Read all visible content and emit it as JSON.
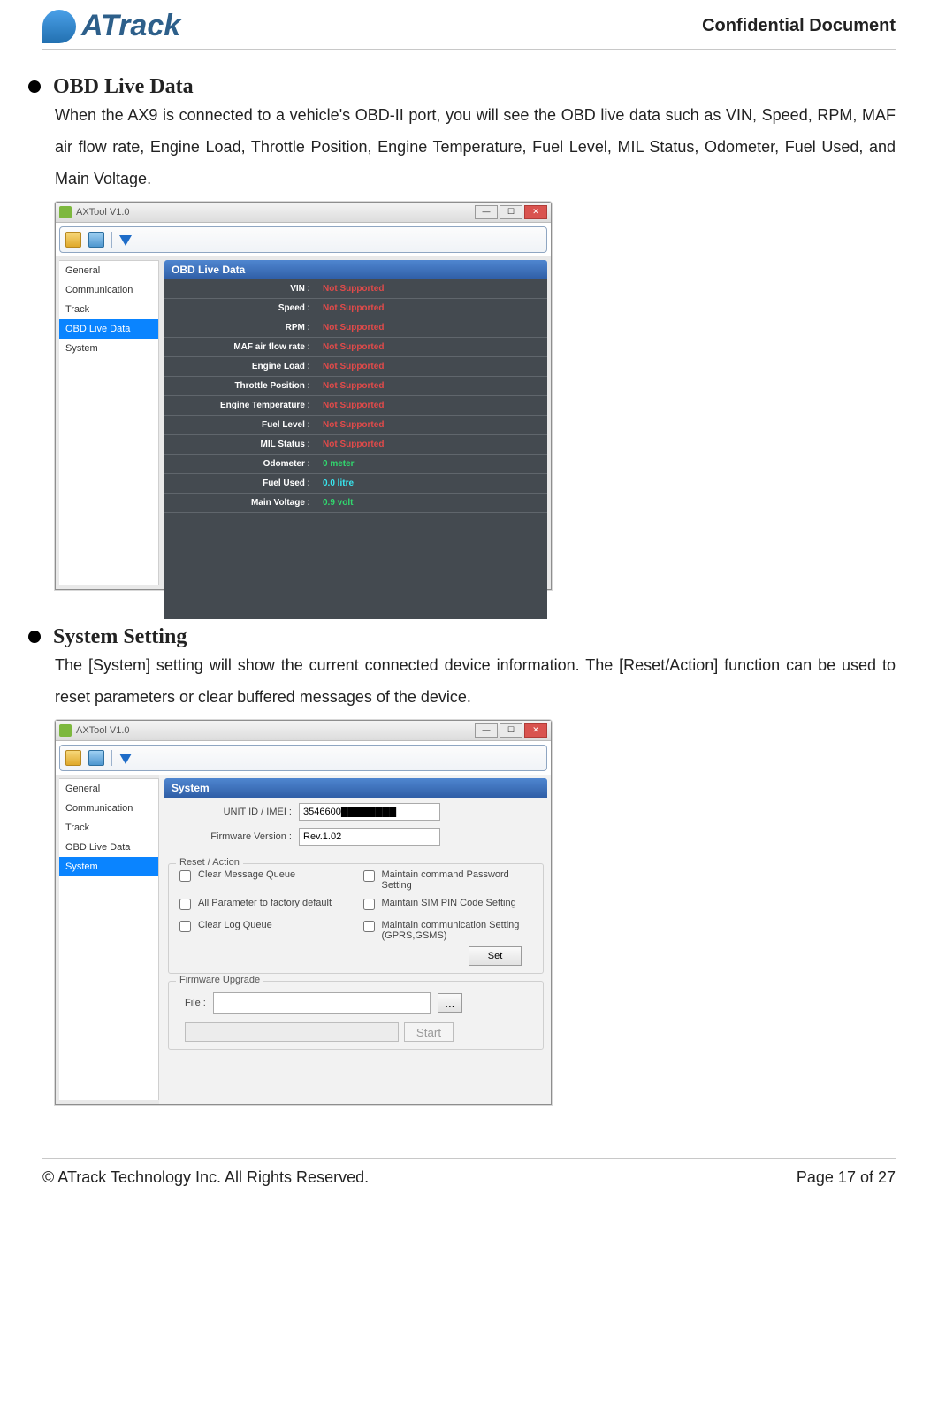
{
  "header": {
    "logo_text": "ATrack",
    "confidential": "Confidential Document"
  },
  "section1": {
    "title": "OBD Live Data",
    "body": "When the AX9 is connected to a vehicle's OBD-II port, you will see the OBD live data such as VIN, Speed, RPM, MAF air flow rate, Engine Load, Throttle Position, Engine Temperature, Fuel Level, MIL Status, Odometer, Fuel Used, and Main Voltage."
  },
  "section2": {
    "title": "System Setting",
    "body": "The [System] setting will show the current connected device information. The [Reset/Action] function can be used to reset parameters or clear buffered messages of the device."
  },
  "axtool": {
    "title": "AXTool V1.0",
    "sidebar": [
      "General",
      "Communication",
      "Track",
      "OBD Live Data",
      "System"
    ]
  },
  "obd": {
    "panel_title": "OBD Live Data",
    "rows": [
      {
        "label": "VIN :",
        "value": "Not Supported",
        "cls": "red"
      },
      {
        "label": "Speed :",
        "value": "Not Supported",
        "cls": "red"
      },
      {
        "label": "RPM :",
        "value": "Not Supported",
        "cls": "red"
      },
      {
        "label": "MAF air flow rate :",
        "value": "Not Supported",
        "cls": "red"
      },
      {
        "label": "Engine Load :",
        "value": "Not Supported",
        "cls": "red"
      },
      {
        "label": "Throttle Position :",
        "value": "Not Supported",
        "cls": "red"
      },
      {
        "label": "Engine Temperature :",
        "value": "Not Supported",
        "cls": "red"
      },
      {
        "label": "Fuel Level :",
        "value": "Not Supported",
        "cls": "red"
      },
      {
        "label": "MIL Status :",
        "value": "Not Supported",
        "cls": "red"
      },
      {
        "label": "Odometer :",
        "value": "0 meter",
        "cls": "green"
      },
      {
        "label": "Fuel Used :",
        "value": "0.0 litre",
        "cls": "cyan"
      },
      {
        "label": "Main Voltage :",
        "value": "0.9 volt",
        "cls": "green"
      }
    ]
  },
  "system": {
    "panel_title": "System",
    "unit_label": "UNIT ID / IMEI :",
    "unit_value": "3546600████████",
    "fw_label": "Firmware Version :",
    "fw_value": "Rev.1.02",
    "reset": {
      "legend": "Reset / Action",
      "checks": [
        "Clear Message Queue",
        "Maintain command Password Setting",
        "All Parameter to factory default",
        "Maintain SIM PIN Code Setting",
        "Clear Log Queue",
        "Maintain communication Setting (GPRS,GSMS)"
      ],
      "set_btn": "Set"
    },
    "fwup": {
      "legend": "Firmware Upgrade",
      "file_label": "File :",
      "browse": "...",
      "start": "Start"
    }
  },
  "footer": {
    "left": "© ATrack Technology Inc. All Rights Reserved.",
    "right": "Page 17 of 27"
  }
}
